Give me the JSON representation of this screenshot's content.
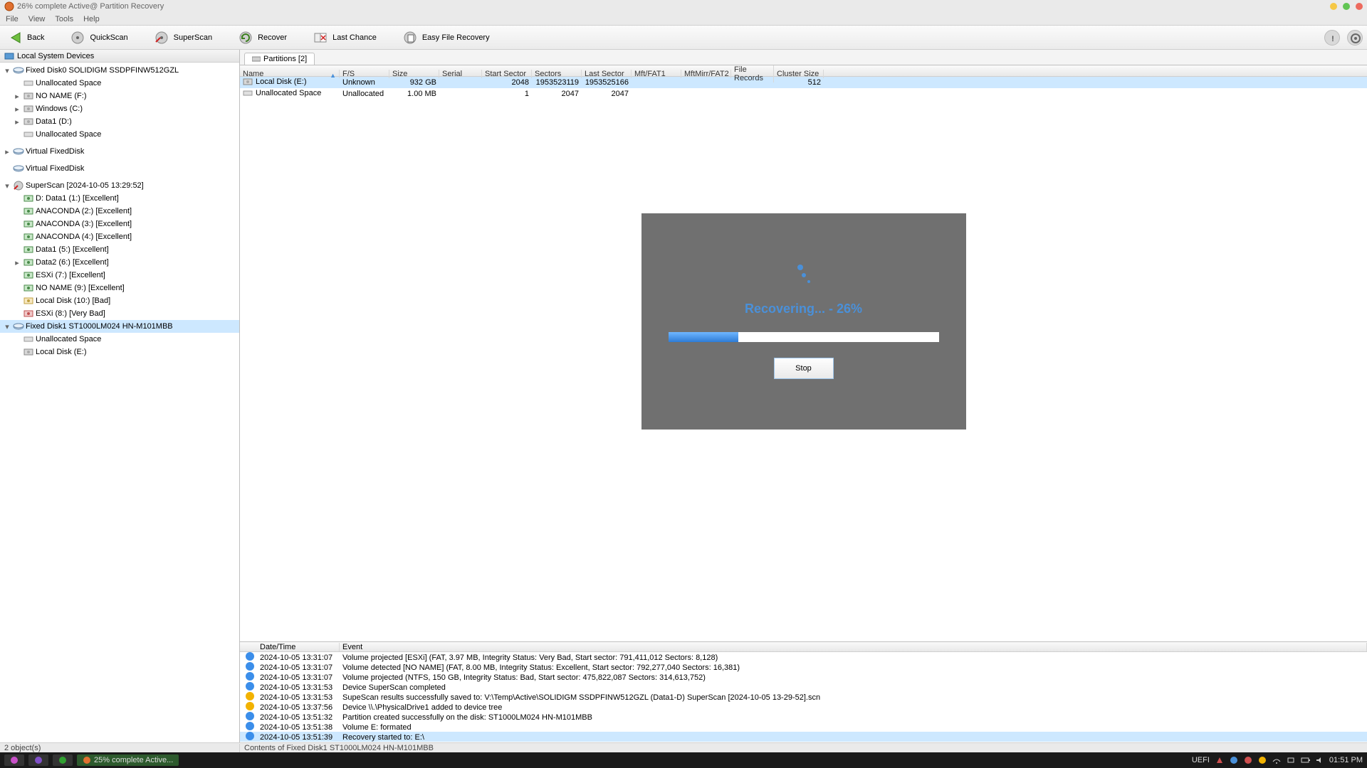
{
  "window": {
    "title": "26% complete Active@ Partition Recovery"
  },
  "menu": {
    "file": "File",
    "view": "View",
    "tools": "Tools",
    "help": "Help"
  },
  "toolbar": {
    "back": "Back",
    "quickscan": "QuickScan",
    "superscan": "SuperScan",
    "recover": "Recover",
    "lastchance": "Last Chance",
    "easyfile": "Easy File Recovery"
  },
  "left_header": "Local System Devices",
  "tree": [
    {
      "lvl": 0,
      "tw": "▾",
      "icon": "disk",
      "label": "Fixed Disk0 SOLIDIGM SSDPFINW512GZL"
    },
    {
      "lvl": 1,
      "tw": "",
      "icon": "unalloc",
      "label": "Unallocated Space"
    },
    {
      "lvl": 1,
      "tw": "▸",
      "icon": "vol",
      "label": "NO NAME (F:)"
    },
    {
      "lvl": 1,
      "tw": "▸",
      "icon": "vol",
      "label": "Windows (C:)"
    },
    {
      "lvl": 1,
      "tw": "▸",
      "icon": "vol",
      "label": "Data1 (D:)"
    },
    {
      "lvl": 1,
      "tw": "",
      "icon": "unalloc",
      "label": "Unallocated Space"
    },
    {
      "lvl": 0,
      "tw": "▸",
      "icon": "disk",
      "label": "Virtual FixedDisk",
      "gap": true
    },
    {
      "lvl": 0,
      "tw": "",
      "icon": "disk",
      "label": "Virtual FixedDisk",
      "gap": true
    },
    {
      "lvl": 0,
      "tw": "▾",
      "icon": "scan",
      "label": "SuperScan [2024-10-05 13:29:52]",
      "gap": true
    },
    {
      "lvl": 1,
      "tw": "",
      "icon": "volg",
      "label": "D: Data1 (1:) [Excellent]"
    },
    {
      "lvl": 1,
      "tw": "",
      "icon": "volg",
      "label": "ANACONDA (2:) [Excellent]"
    },
    {
      "lvl": 1,
      "tw": "",
      "icon": "volg",
      "label": "ANACONDA (3:) [Excellent]"
    },
    {
      "lvl": 1,
      "tw": "",
      "icon": "volg",
      "label": "ANACONDA (4:) [Excellent]"
    },
    {
      "lvl": 1,
      "tw": "",
      "icon": "volg",
      "label": "Data1 (5:) [Excellent]"
    },
    {
      "lvl": 1,
      "tw": "▸",
      "icon": "volg",
      "label": "Data2 (6:) [Excellent]"
    },
    {
      "lvl": 1,
      "tw": "",
      "icon": "volg",
      "label": "ESXi (7:) [Excellent]"
    },
    {
      "lvl": 1,
      "tw": "",
      "icon": "volg",
      "label": "NO NAME (9:) [Excellent]"
    },
    {
      "lvl": 1,
      "tw": "",
      "icon": "voly",
      "label": "Local Disk (10:) [Bad]"
    },
    {
      "lvl": 1,
      "tw": "",
      "icon": "volr",
      "label": "ESXi (8:) [Very Bad]"
    },
    {
      "lvl": 0,
      "tw": "▾",
      "icon": "disk",
      "label": "Fixed Disk1 ST1000LM024 HN-M101MBB",
      "sel": true
    },
    {
      "lvl": 1,
      "tw": "",
      "icon": "unalloc",
      "label": "Unallocated Space"
    },
    {
      "lvl": 1,
      "tw": "",
      "icon": "vol",
      "label": "Local Disk (E:)"
    }
  ],
  "tab_label": "Partitions [2]",
  "grid": {
    "cols": [
      "Name",
      "F/S",
      "Size",
      "Serial",
      "Start Sector",
      "Sectors",
      "Last Sector",
      "Mft/FAT1",
      "MftMirr/FAT2",
      "File Records",
      "Cluster Size"
    ],
    "rows": [
      {
        "sel": true,
        "name": "Local Disk (E:)",
        "fs": "Unknown",
        "size": "932 GB",
        "serial": "",
        "start": "2048",
        "sectors": "1953523119",
        "last": "1953525166",
        "mft": "",
        "mftm": "",
        "fr": "",
        "cs": "512"
      },
      {
        "sel": false,
        "name": "Unallocated Space",
        "fs": "Unallocated",
        "size": "1.00 MB",
        "serial": "",
        "start": "1",
        "sectors": "2047",
        "last": "2047",
        "mft": "",
        "mftm": "",
        "fr": "",
        "cs": ""
      }
    ]
  },
  "recover": {
    "text": "Recovering... - 26%",
    "percent": 26,
    "stop": "Stop"
  },
  "log": {
    "cols": [
      "",
      "Date/Time",
      "Event"
    ],
    "rows": [
      {
        "t": "info",
        "d": "2024-10-05 13:31:07",
        "e": "Volume projected [ESXi] (FAT, 3.97 MB, Integrity Status: Very Bad, Start sector: 791,411,012 Sectors: 8,128)"
      },
      {
        "t": "info",
        "d": "2024-10-05 13:31:07",
        "e": "Volume detected [NO NAME] (FAT, 8.00 MB, Integrity Status: Excellent, Start sector: 792,277,040 Sectors: 16,381)"
      },
      {
        "t": "info",
        "d": "2024-10-05 13:31:07",
        "e": "Volume projected (NTFS, 150 GB, Integrity Status: Bad, Start sector: 475,822,087 Sectors: 314,613,752)"
      },
      {
        "t": "info",
        "d": "2024-10-05 13:31:53",
        "e": "Device SuperScan completed"
      },
      {
        "t": "warn",
        "d": "2024-10-05 13:31:53",
        "e": "SupeScan results successfully saved to: V:\\Temp\\Active\\SOLIDIGM SSDPFINW512GZL (Data1-D) SuperScan [2024-10-05 13-29-52].scn"
      },
      {
        "t": "warn",
        "d": "2024-10-05 13:37:56",
        "e": "Device \\\\.\\PhysicalDrive1 added to device tree"
      },
      {
        "t": "info",
        "d": "2024-10-05 13:51:32",
        "e": "Partition created successfully on the disk: ST1000LM024 HN-M101MBB"
      },
      {
        "t": "info",
        "d": "2024-10-05 13:51:38",
        "e": "Volume E: formated"
      },
      {
        "t": "info",
        "d": "2024-10-05 13:51:39",
        "e": "Recovery started to: E:\\",
        "sel": true
      }
    ]
  },
  "status": {
    "left": "2 object(s)",
    "right": "Contents of Fixed Disk1 ST1000LM024 HN-M101MBB"
  },
  "taskbar": {
    "app": "25% complete Active...",
    "uefi": "UEFI",
    "clock": "01:51 PM"
  }
}
